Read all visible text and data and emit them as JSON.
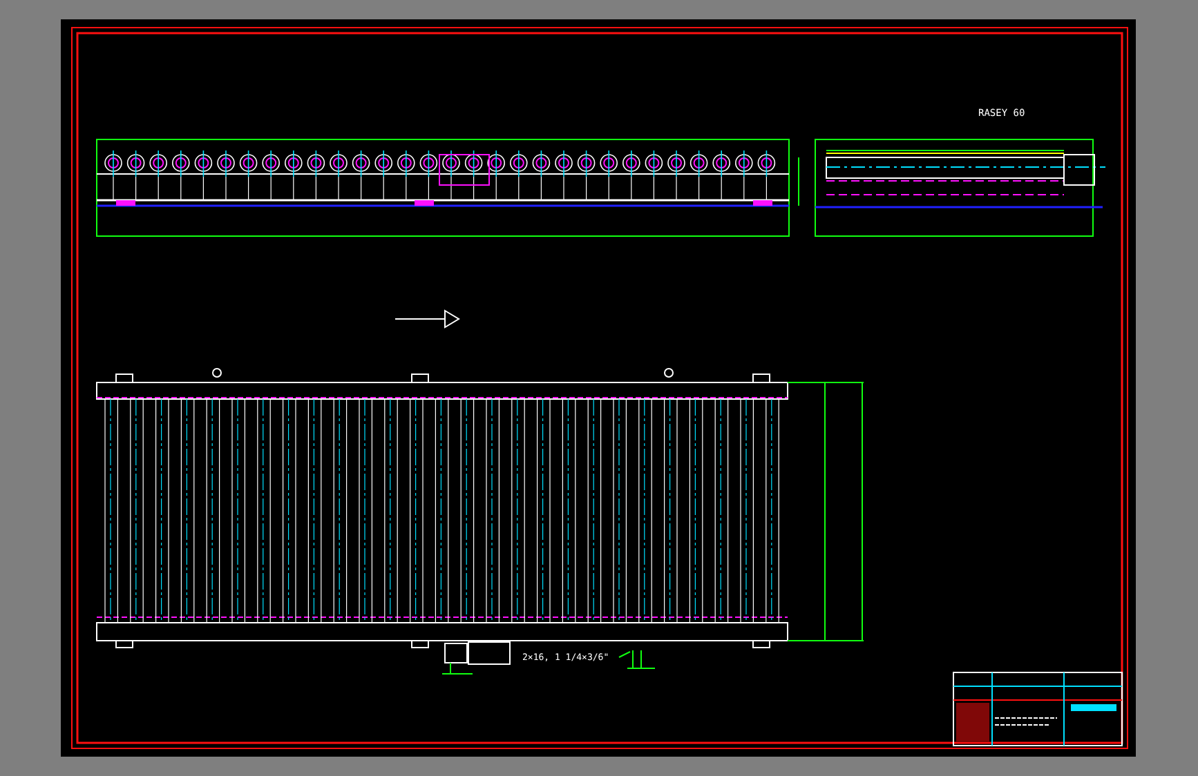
{
  "drawing": {
    "view_title": "RASEY 60",
    "callout": "2×16, 1 1/4×3/6\""
  }
}
